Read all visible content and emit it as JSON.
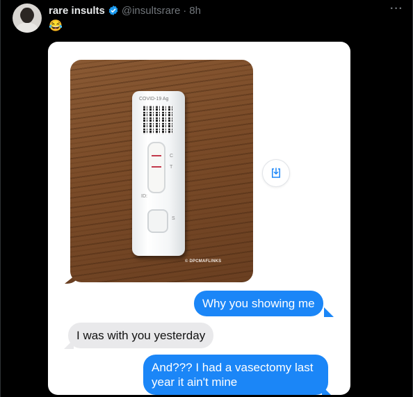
{
  "tweet": {
    "display_name": "rare insults",
    "handle": "@insultsrare",
    "separator": "·",
    "time": "8h",
    "body_emoji": "😂",
    "more_menu": "···",
    "verified_icon": "verified-badge-icon",
    "accent_color": "#1d9bf0"
  },
  "media": {
    "photo": {
      "device_label": "COVID-19 Ag",
      "mark_c": "C",
      "mark_t": "T",
      "mark_id": "ID:",
      "mark_s": "S",
      "watermark": "© DPCMAFLINKS"
    },
    "save_icon": "download-icon",
    "messages": [
      {
        "text": "Why you showing me",
        "side": "sent"
      },
      {
        "text": "I was with you yesterday",
        "side": "received"
      },
      {
        "text": "And??? I had a vasectomy last year it ain't mine",
        "side": "sent"
      }
    ],
    "colors": {
      "sent_bubble": "#1b86f7",
      "received_bubble": "#e9e9eb"
    }
  }
}
